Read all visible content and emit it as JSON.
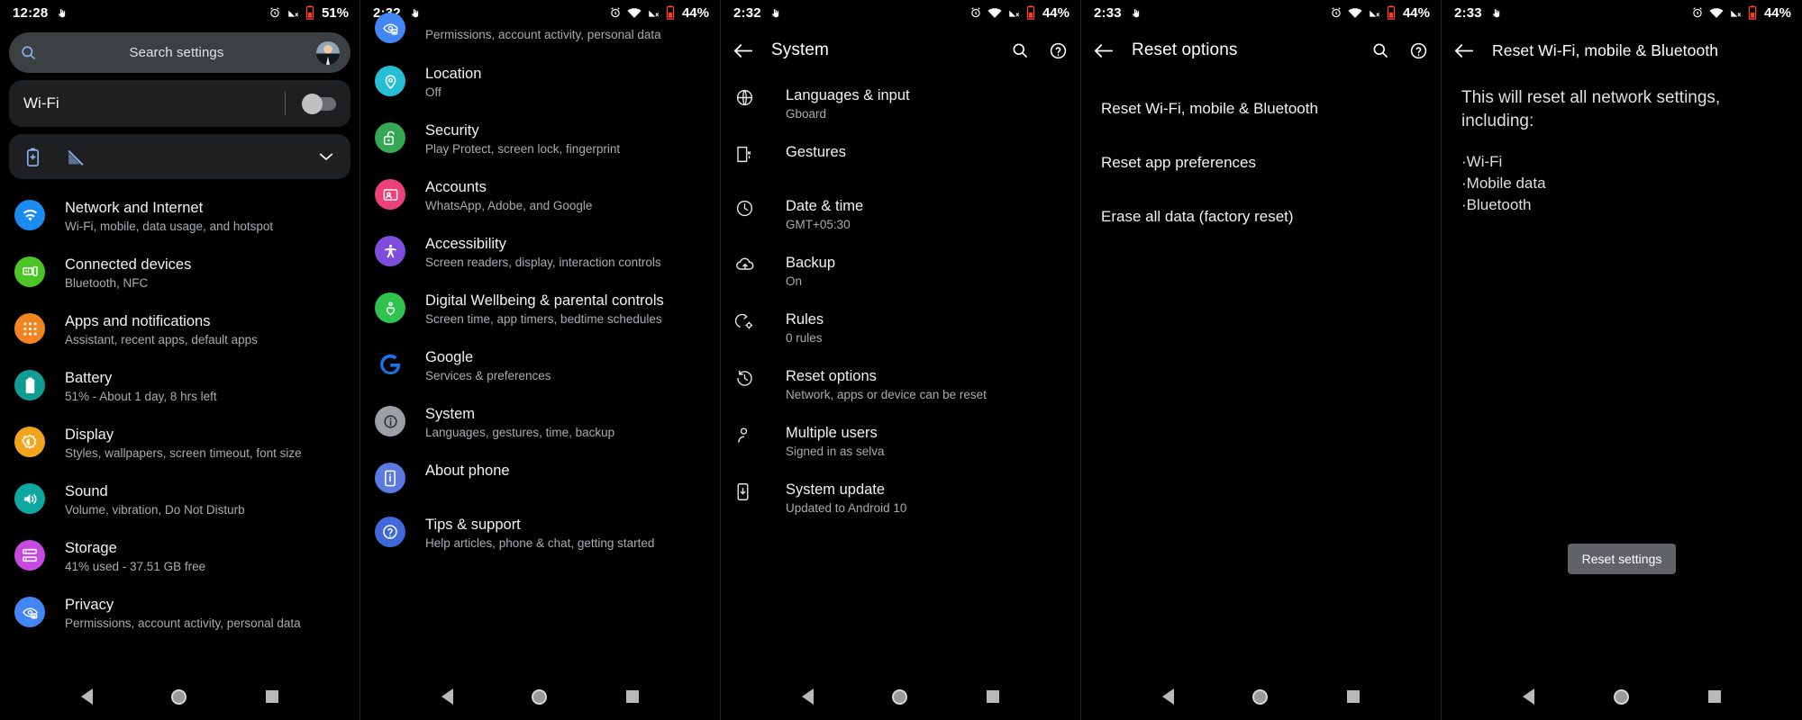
{
  "colors": {
    "accent_blue": "#1a73e8",
    "green": "#34a853",
    "orange": "#f2851f",
    "teal": "#0f9d93",
    "purple": "#c44ae0",
    "pink": "#ec407a",
    "violet": "#7e4ddd",
    "cyan": "#26bfd4",
    "grey": "#9aa0a6",
    "indigo": "#5c79e0",
    "battery_red": "#e8422b",
    "button_grey": "#5f6368"
  },
  "panels": [
    {
      "id": "settings-home",
      "status": {
        "time": "12:28",
        "battery_pct": "51%",
        "icons": [
          "touch-icon",
          "alarm-icon",
          "signal-off-icon",
          "battery-low-icon"
        ]
      },
      "search": {
        "placeholder": "Search settings",
        "icon": "search-icon",
        "avatar": "user-avatar"
      },
      "wifi_card": {
        "label": "Wi-Fi",
        "toggle_state": "off"
      },
      "quick_card": {
        "icons": [
          "battery-saver-icon",
          "signal-off-icon"
        ],
        "expand_icon": "chevron-down-icon"
      },
      "items": [
        {
          "title": "Network and Internet",
          "sub": "Wi-Fi, mobile, data usage, and hotspot",
          "icon": "wifi-icon",
          "color": "#1a8cf0"
        },
        {
          "title": "Connected devices",
          "sub": "Bluetooth, NFC",
          "icon": "cast-icon",
          "color": "#4bc425"
        },
        {
          "title": "Apps and notifications",
          "sub": "Assistant, recent apps, default apps",
          "icon": "apps-grid-icon",
          "color": "#f2851f"
        },
        {
          "title": "Battery",
          "sub": "51% - About 1 day, 8 hrs left",
          "icon": "battery-icon",
          "color": "#0f9d93"
        },
        {
          "title": "Display",
          "sub": "Styles, wallpapers, screen timeout, font size",
          "icon": "brightness-icon",
          "color": "#f2a41f"
        },
        {
          "title": "Sound",
          "sub": "Volume, vibration, Do Not Disturb",
          "icon": "speaker-icon",
          "color": "#0fa8a0"
        },
        {
          "title": "Storage",
          "sub": "41% used - 37.51 GB free",
          "icon": "storage-icon",
          "color": "#c44ae0"
        },
        {
          "title": "Privacy",
          "sub": "Permissions, account activity, personal data",
          "icon": "privacy-eye-icon",
          "color": "#4285f4"
        }
      ]
    },
    {
      "id": "settings-home-scrolled",
      "status": {
        "time": "2:32",
        "battery_pct": "44%",
        "icons": [
          "touch-icon",
          "alarm-icon",
          "wifi-icon",
          "signal-off-icon",
          "battery-low-icon"
        ]
      },
      "partial_top": {
        "sub": "Permissions, account activity, personal data",
        "icon": "privacy-eye-icon",
        "color": "#4285f4"
      },
      "items": [
        {
          "title": "Location",
          "sub": "Off",
          "icon": "location-pin-icon",
          "color": "#26bfd4"
        },
        {
          "title": "Security",
          "sub": "Play Protect, screen lock, fingerprint",
          "icon": "lock-open-icon",
          "color": "#34a853"
        },
        {
          "title": "Accounts",
          "sub": "WhatsApp, Adobe, and Google",
          "icon": "account-card-icon",
          "color": "#ec407a"
        },
        {
          "title": "Accessibility",
          "sub": "Screen readers, display, interaction controls",
          "icon": "accessibility-icon",
          "color": "#7e4ddd"
        },
        {
          "title": "Digital Wellbeing & parental controls",
          "sub": "Screen time, app timers, bedtime schedules",
          "icon": "wellbeing-heart-icon",
          "color": "#2fc24d"
        },
        {
          "title": "Google",
          "sub": "Services & preferences",
          "icon": "google-g-icon",
          "color": "#1a73e8"
        },
        {
          "title": "System",
          "sub": "Languages, gestures, time, backup",
          "icon": "info-circle-icon",
          "color": "#9aa0a6"
        },
        {
          "title": "About phone",
          "sub": "",
          "icon": "phone-info-icon",
          "color": "#5c79e0"
        },
        {
          "title": "Tips & support",
          "sub": "Help articles, phone & chat, getting started",
          "icon": "help-circle-icon",
          "color": "#3f68d8"
        }
      ]
    },
    {
      "id": "system",
      "status": {
        "time": "2:32",
        "battery_pct": "44%",
        "icons": [
          "touch-icon",
          "alarm-icon",
          "wifi-icon",
          "signal-off-icon",
          "battery-low-icon"
        ]
      },
      "appbar": {
        "title": "System",
        "back_icon": "back-arrow-icon",
        "actions": [
          "search-icon",
          "help-icon"
        ]
      },
      "items": [
        {
          "title": "Languages & input",
          "sub": "Gboard",
          "icon": "globe-icon"
        },
        {
          "title": "Gestures",
          "sub": "",
          "icon": "gesture-icon"
        },
        {
          "title": "Date & time",
          "sub": "GMT+05:30",
          "icon": "clock-icon"
        },
        {
          "title": "Backup",
          "sub": "On",
          "icon": "cloud-upload-icon"
        },
        {
          "title": "Rules",
          "sub": "0 rules",
          "icon": "rules-icon"
        },
        {
          "title": "Reset options",
          "sub": "Network, apps or device can be reset",
          "icon": "history-restore-icon"
        },
        {
          "title": "Multiple users",
          "sub": "Signed in as selva",
          "icon": "person-icon"
        },
        {
          "title": "System update",
          "sub": "Updated to Android 10",
          "icon": "phone-download-icon"
        }
      ]
    },
    {
      "id": "reset-options",
      "status": {
        "time": "2:33",
        "battery_pct": "44%",
        "icons": [
          "touch-icon",
          "alarm-icon",
          "wifi-icon",
          "signal-off-icon",
          "battery-low-icon"
        ]
      },
      "appbar": {
        "title": "Reset options",
        "back_icon": "back-arrow-icon",
        "actions": [
          "search-icon",
          "help-icon"
        ]
      },
      "items": [
        {
          "title": "Reset Wi-Fi, mobile & Bluetooth",
          "sub": ""
        },
        {
          "title": "Reset app preferences",
          "sub": ""
        },
        {
          "title": "Erase all data (factory reset)",
          "sub": ""
        }
      ]
    },
    {
      "id": "reset-network",
      "status": {
        "time": "2:33",
        "battery_pct": "44%",
        "icons": [
          "touch-icon",
          "alarm-icon",
          "wifi-icon",
          "signal-off-icon",
          "battery-low-icon"
        ]
      },
      "appbar": {
        "title": "Reset Wi-Fi, mobile & Bluetooth",
        "back_icon": "back-arrow-icon",
        "actions": []
      },
      "lead": "This will reset all network settings, including:",
      "bullets": [
        "·Wi-Fi",
        "·Mobile data",
        "·Bluetooth"
      ],
      "button_label": "Reset settings"
    }
  ],
  "navbar": {
    "back": "back-triangle-icon",
    "home": "home-circle-icon",
    "recents": "recents-square-icon"
  }
}
